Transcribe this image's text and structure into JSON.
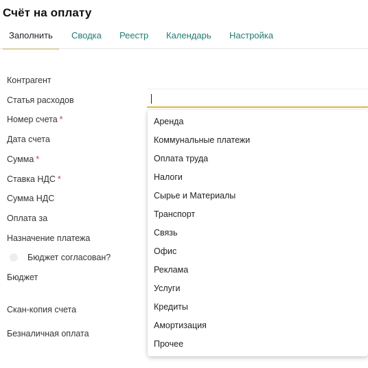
{
  "header": {
    "title": "Счёт на оплату"
  },
  "tabs": [
    {
      "label": "Заполнить",
      "active": true
    },
    {
      "label": "Сводка",
      "active": false
    },
    {
      "label": "Реестр",
      "active": false
    },
    {
      "label": "Календарь",
      "active": false
    },
    {
      "label": "Настройка",
      "active": false
    }
  ],
  "form": {
    "fields": [
      {
        "label": "Контрагент",
        "required": false
      },
      {
        "label": "Статья расходов",
        "required": false
      },
      {
        "label": "Номер счета",
        "required": true
      },
      {
        "label": "Дата счета",
        "required": false
      },
      {
        "label": "Сумма",
        "required": true
      },
      {
        "label": "Ставка НДС",
        "required": true
      },
      {
        "label": "Сумма НДС",
        "required": false
      },
      {
        "label": "Оплата за",
        "required": false
      },
      {
        "label": "Назначение платежа",
        "required": false
      },
      {
        "label": "Бюджет",
        "required": false
      },
      {
        "label": "Скан-копия счета",
        "required": false
      },
      {
        "label": "Безналичная оплата",
        "required": false
      }
    ],
    "required_marker": "*",
    "budget_checkbox": {
      "label": "Бюджет согласован?",
      "checked": false
    },
    "expense_input": {
      "value": ""
    }
  },
  "dropdown": {
    "options": [
      "Аренда",
      "Коммунальные платежи",
      "Оплата труда",
      "Налоги",
      "Сырье и Материалы",
      "Транспорт",
      "Связь",
      "Офис",
      "Реклама",
      "Услуги",
      "Кредиты",
      "Амортизация",
      "Прочее"
    ]
  },
  "colors": {
    "accent": "#e8b92e",
    "tab_link": "#1a7f72",
    "required": "#d33a3a"
  }
}
